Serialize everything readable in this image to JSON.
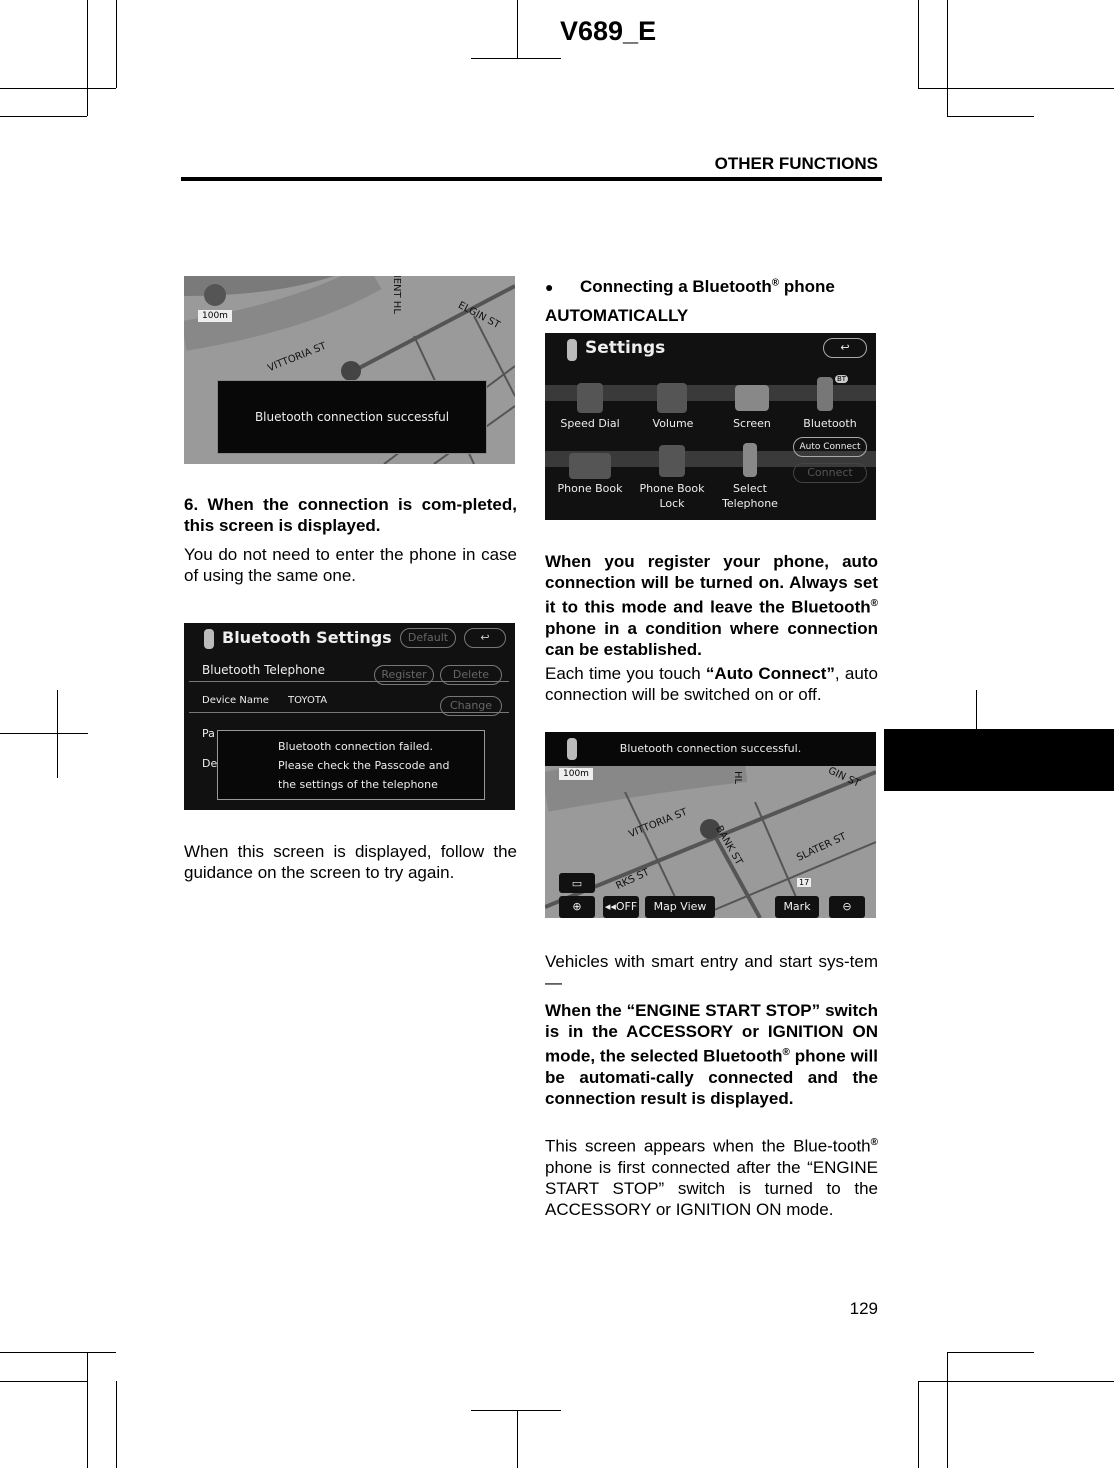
{
  "header": {
    "doc_code": "V689_E",
    "section": "OTHER FUNCTIONS"
  },
  "left": {
    "screen1": {
      "message": "Bluetooth connection successful",
      "scale": "100m",
      "streets": [
        "MENT HL",
        "ELGIN ST",
        "VITTORIA ST",
        "BA"
      ]
    },
    "step6_heading": "6.  When  the  connection  is  com-pleted, this screen is displayed.",
    "step6_body": "You  do  not  need  to  enter  the  phone  in case of using the same one.",
    "screen2": {
      "title": "Bluetooth Settings",
      "default": "Default",
      "row1": "Bluetooth Telephone",
      "register": "Register",
      "delete": "Delete",
      "device_label": "Device Name",
      "device_value": "TOYOTA",
      "change": "Change",
      "row3": "Pa",
      "row4": "De",
      "message": [
        "Bluetooth connection failed.",
        "Please check the Passcode and",
        "the settings of the telephone"
      ]
    },
    "failed_body": "When this screen is displayed, follow the guidance on the screen to try again."
  },
  "right": {
    "bullet": "●",
    "heading_pre": "Connecting a Bluetooth",
    "heading_post": " phone",
    "reg": "®",
    "subheading": "AUTOMATICALLY",
    "screen3": {
      "title": "Settings",
      "items": [
        "Speed Dial",
        "Volume",
        "Screen",
        "Bluetooth",
        "Phone Book",
        "Phone Book Lock",
        "Select Telephone"
      ],
      "auto_connect": "Auto Connect",
      "connect": "Connect",
      "bt_badge": "BT"
    },
    "bold1_pre": "When  you  register  your  phone,  auto connection  will  be  turned  on.  Always set  it  to  this  mode  and  leave  the Bluetooth",
    "bold1_post": "  phone  in  a  condition where connection can be established.",
    "para2_pre": "Each  time  you  touch  ",
    "para2_bold": "“Auto Connect”",
    "para2_post": ", auto  connection  will  be  switched  on  or off.",
    "screen4": {
      "message": "Bluetooth connection successful.",
      "scale": "100m",
      "streets": [
        "HL",
        "GIN ST",
        "VITTORIA ST",
        "BANK ST",
        "SLATER ST",
        "RKS ST"
      ],
      "route": "17",
      "buttons": {
        "zoom_in": "⊕",
        "off": "◂◂OFF",
        "map_view": "Map View",
        "mark": "Mark",
        "zoom_out": "⊖"
      }
    },
    "para3": "Vehicles  with  smart  entry  and  start  sys-tem—",
    "bold2_pre": "When  the  “ENGINE  START  STOP” switch  is  in  the  ACCESSORY  or IGNITION  ON  mode,  the  selected Bluetooth",
    "bold2_post": "  phone  will  be  automati-cally  connected  and  the  connection result is displayed.",
    "para4_pre": "This  screen  appears  when  the  Blue-tooth",
    "para4_post": " phone is first connected after the “ENGINE START STOP” switch is turned to  the  ACCESSORY  or  IGNITION  ON mode."
  },
  "footer": {
    "page_number": "129"
  }
}
